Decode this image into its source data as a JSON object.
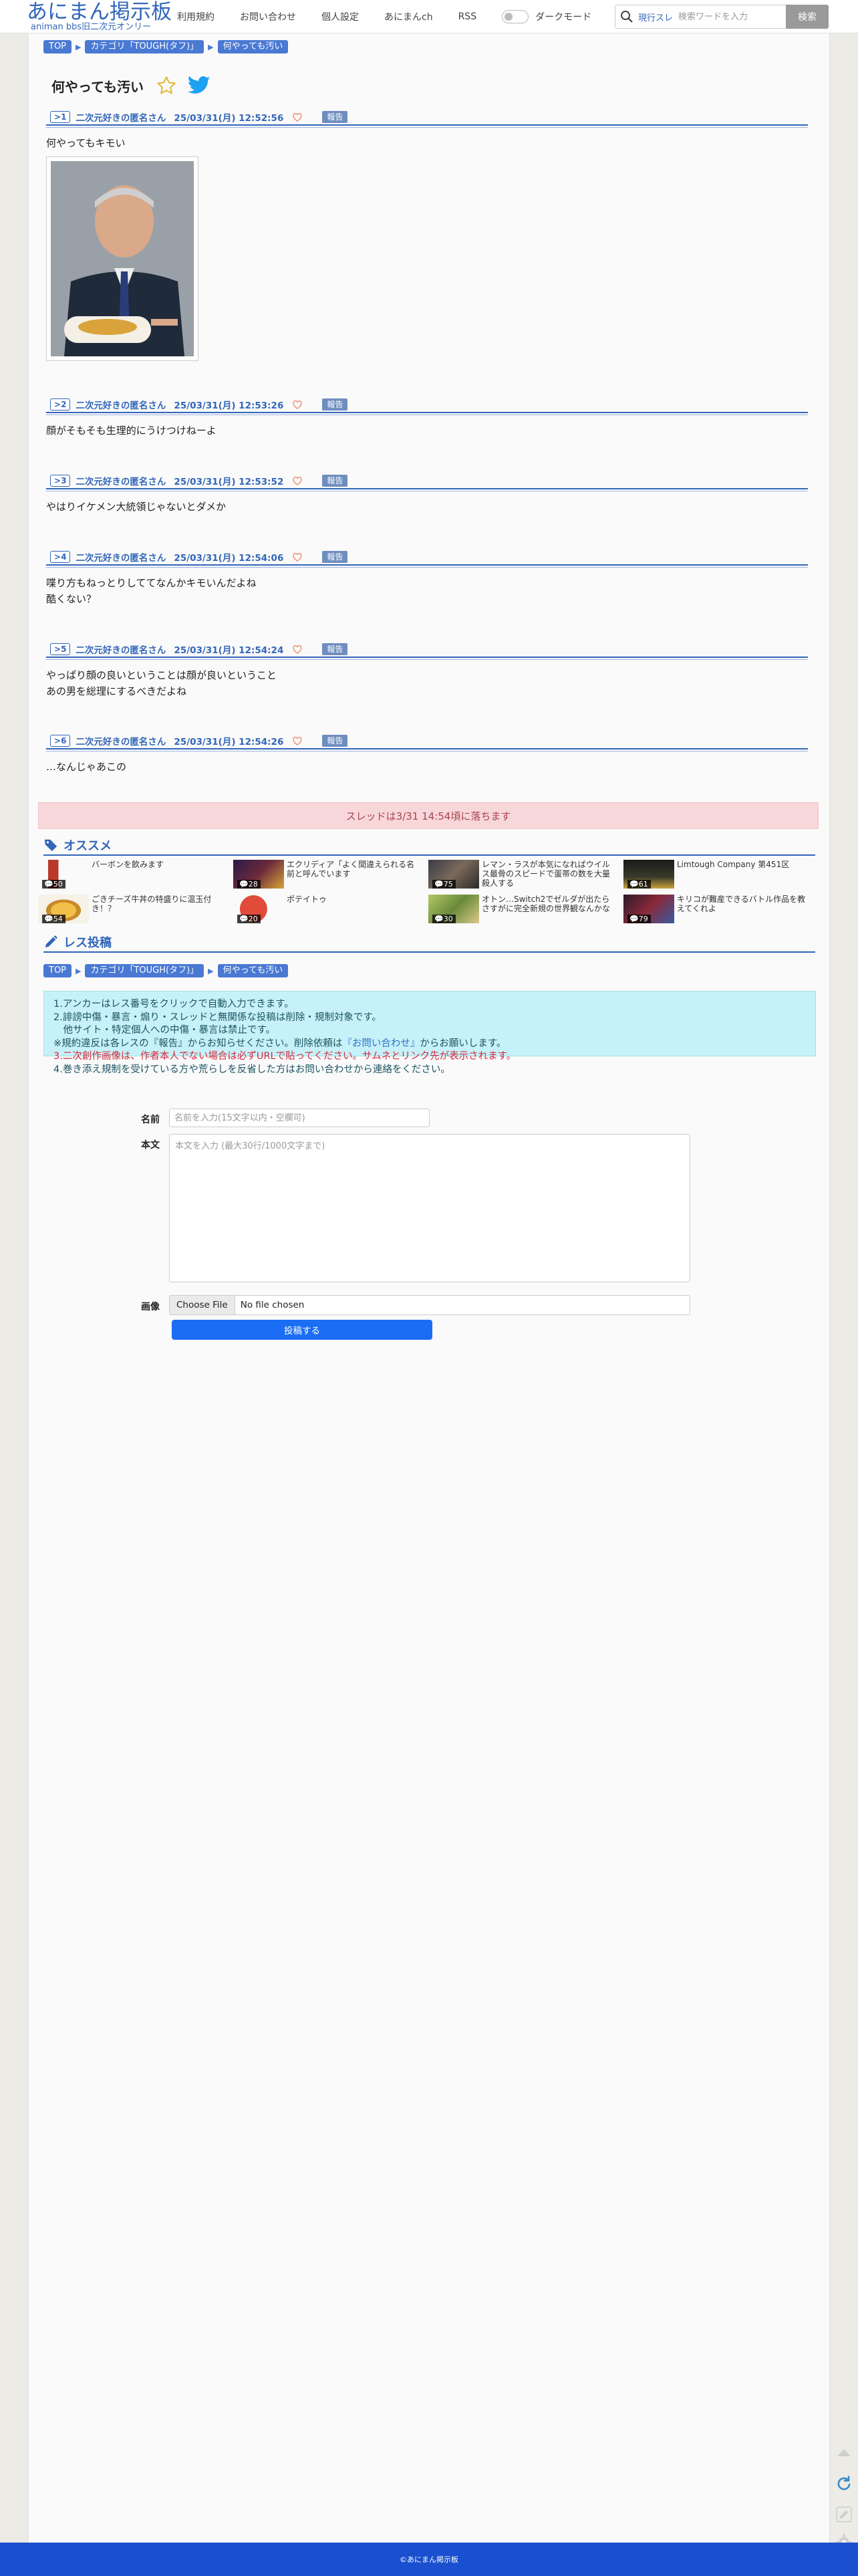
{
  "header": {
    "logo_main": "あにまん掲示板",
    "logo_sub": "animan bbs旧二次元オンリー",
    "nav": [
      "利用規約",
      "お問い合わせ",
      "個人設定",
      "あにまんch",
      "RSS"
    ],
    "dark_mode_label": "ダークモード",
    "search_mode": "現行スレ",
    "search_placeholder": "検索ワードを入力",
    "search_button": "検索"
  },
  "breadcrumb": {
    "top": "TOP",
    "category": "カテゴリ「TOUGH(タフ)」",
    "current": "何やっても汚い"
  },
  "thread": {
    "title": "何やっても汚い"
  },
  "posts": [
    {
      "num": "1",
      "name": "二次元好きの匿名さん",
      "date": "25/03/31(月) 12:52:56",
      "report": "報告",
      "lines": [
        "何やってもキモい"
      ],
      "has_image": true
    },
    {
      "num": "2",
      "name": "二次元好きの匿名さん",
      "date": "25/03/31(月) 12:53:26",
      "report": "報告",
      "lines": [
        "顔がそもそも生理的にうけつけねーよ"
      ]
    },
    {
      "num": "3",
      "name": "二次元好きの匿名さん",
      "date": "25/03/31(月) 12:53:52",
      "report": "報告",
      "lines": [
        "やはりイケメン大統領じゃないとダメか"
      ]
    },
    {
      "num": "4",
      "name": "二次元好きの匿名さん",
      "date": "25/03/31(月) 12:54:06",
      "report": "報告",
      "lines": [
        "喋り方もねっとりしててなんかキモいんだよね",
        "酷くない？"
      ]
    },
    {
      "num": "5",
      "name": "二次元好きの匿名さん",
      "date": "25/03/31(月) 12:54:24",
      "report": "報告",
      "lines": [
        "やっぱり顔の良いということは顔が良いということ",
        "あの男を総理にするべきだよね"
      ]
    },
    {
      "num": "6",
      "name": "二次元好きの匿名さん",
      "date": "25/03/31(月) 12:54:26",
      "report": "報告",
      "lines": [
        "…なんじゃあこの"
      ]
    }
  ],
  "expired_notice": "スレッドは3/31 14:54頃に落ちます",
  "recommend": {
    "title": "オススメ",
    "items": [
      {
        "count": "50",
        "text": "バーボンを飲みます",
        "color": "#b93a2a"
      },
      {
        "count": "28",
        "text": "エクリディア「よく間違えられる名前と呼んでいます",
        "color": "#4a2a6a"
      },
      {
        "count": "75",
        "text": "レマン・ラスが本気になればウイルス最骨のスピードで蛋帯の数を大量殺人する",
        "color": "#5a4a3a"
      },
      {
        "count": "61",
        "text": "Limtough Company 第451区",
        "color": "#2a2a2a"
      },
      {
        "count": "54",
        "text": "ごきチーズ牛丼の特盛りに温玉付き！？",
        "color": "#d9a23a"
      },
      {
        "count": "20",
        "text": "ポテイトゥ",
        "color": "#c23a2a"
      },
      {
        "count": "30",
        "text": "オトン…Switch2でゼルダが出たらさすがに完全新規の世界観なんかな",
        "color": "#8aa24a"
      },
      {
        "count": "79",
        "text": "キリコが難産できるバトル作品を教えてくれよ",
        "color": "#3a2a3a"
      }
    ]
  },
  "reply": {
    "title": "レス投稿",
    "notice_lines": [
      [
        {
          "t": "1.アンカーはレス番号をクリックで自動入力できます。",
          "c": ""
        }
      ],
      [
        {
          "t": "2.誹謗中傷・暴言・煽り・スレッドと無関係な投稿は削除・規制対象です。",
          "c": ""
        }
      ],
      [
        {
          "t": "　他サイト・特定個人への中傷・暴言は禁止です。",
          "c": ""
        }
      ],
      [
        {
          "t": "※規約違反は各レスの『報告』からお知らせください。削除依頼は",
          "c": ""
        },
        {
          "t": "『お問い合わせ』",
          "c": "blue"
        },
        {
          "t": "からお願いします。",
          "c": ""
        }
      ],
      [
        {
          "t": "3.二次創作画像は、作者本人でない場合は必ずURLで貼ってください。サムネとリンク先が表示されます。",
          "c": "red"
        }
      ],
      [
        {
          "t": "4.巻き添え規制を受けている方や荒らしを反省した方はお問い合わせから連絡をください。",
          "c": ""
        }
      ]
    ],
    "name_label": "名前",
    "name_placeholder": "名前を入力(15文字以内・空欄可)",
    "body_label": "本文",
    "body_placeholder": "本文を入力 (最大30行/1000文字まで)",
    "image_label": "画像",
    "file_button": "Choose File",
    "file_status": "No file chosen",
    "submit": "投稿する"
  },
  "footer": {
    "copyright": "©あにまん掲示板"
  },
  "colors": {
    "accent": "#3266b9",
    "footer": "#1a4fcf",
    "notice_bg": "#c7f1f8",
    "expired_bg": "#f7d7da"
  }
}
